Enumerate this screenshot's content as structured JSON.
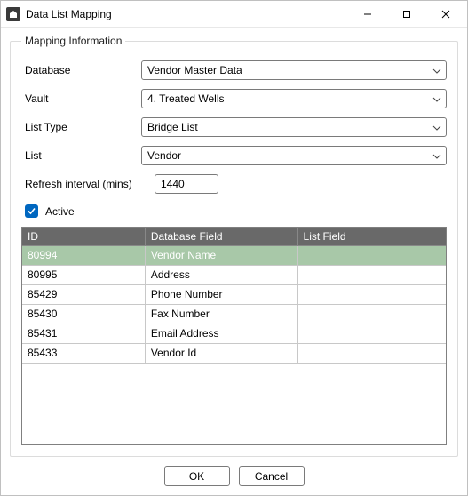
{
  "window": {
    "title": "Data List Mapping"
  },
  "group": {
    "legend": "Mapping Information"
  },
  "labels": {
    "database": "Database",
    "vault": "Vault",
    "listType": "List Type",
    "list": "List",
    "refresh": "Refresh interval (mins)",
    "active": "Active"
  },
  "values": {
    "database": "Vendor Master Data",
    "vault": "4. Treated Wells",
    "listType": "Bridge List",
    "list": "Vendor",
    "refresh": "1440",
    "activeChecked": true
  },
  "grid": {
    "headers": {
      "id": "ID",
      "dbField": "Database Field",
      "listField": "List Field"
    },
    "rows": [
      {
        "id": "80994",
        "dbField": "Vendor Name",
        "listField": "",
        "selected": true
      },
      {
        "id": "80995",
        "dbField": "Address",
        "listField": "",
        "selected": false
      },
      {
        "id": "85429",
        "dbField": "Phone Number",
        "listField": "",
        "selected": false
      },
      {
        "id": "85430",
        "dbField": "Fax Number",
        "listField": "",
        "selected": false
      },
      {
        "id": "85431",
        "dbField": "Email Address",
        "listField": "",
        "selected": false
      },
      {
        "id": "85433",
        "dbField": "Vendor Id",
        "listField": "",
        "selected": false
      }
    ]
  },
  "buttons": {
    "ok": "OK",
    "cancel": "Cancel"
  }
}
